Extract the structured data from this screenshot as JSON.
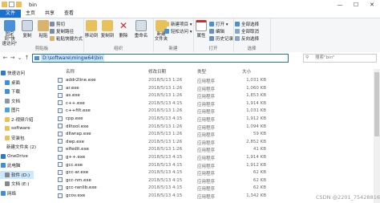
{
  "window": {
    "title": "bin",
    "minimize": "—",
    "maximize": "☐",
    "close": "✕"
  },
  "tabs": [
    "文件",
    "主页",
    "共享",
    "查看"
  ],
  "ribbon": {
    "clipboard": {
      "label": "剪贴板",
      "pin": "固定到\"快\n速访问\"",
      "copy": "复制",
      "paste": "粘贴",
      "cut": "剪切",
      "copy_path": "复制路径",
      "paste_shortcut": "粘贴快捷方式"
    },
    "organize": {
      "label": "组织",
      "move_to": "移动到",
      "copy_to": "复制到",
      "delete": "删除",
      "rename": "重命名"
    },
    "new": {
      "label": "新建",
      "new_folder": "新建\n文件夹",
      "new_item": "新建项目 ▾",
      "easy_access": "轻松访问 ▾"
    },
    "open": {
      "label": "打开",
      "properties": "属性",
      "open": "打开 ▾",
      "edit": "编辑",
      "history": "历史记录"
    },
    "select": {
      "label": "选择",
      "select_all": "全部选择",
      "select_none": "全部取消",
      "invert": "反向选择"
    }
  },
  "navbar": {
    "back": "←",
    "forward": "→",
    "recent": "⌄",
    "up": "↑",
    "path": "D:\\software\\mingw64\\bin",
    "search_placeholder": "搜索\"bin\"",
    "search_icon": "⚲"
  },
  "nav_pane": [
    {
      "label": "快速访问",
      "icon": "star-icon",
      "color": "#2b78d4"
    },
    {
      "label": "桌面",
      "icon": "desktop-icon",
      "color": "#3a8fdf"
    },
    {
      "label": "下载",
      "icon": "download-icon",
      "color": "#3a8fdf"
    },
    {
      "label": "文档",
      "icon": "document-icon",
      "color": "#8a97a6"
    },
    {
      "label": "图片",
      "icon": "picture-icon",
      "color": "#4aa3df"
    },
    {
      "label": "2-视频介绍",
      "icon": "folder-icon",
      "color": "#e8c15a"
    },
    {
      "label": "software",
      "icon": "folder-icon",
      "color": "#e8c15a"
    },
    {
      "label": "安装包",
      "icon": "folder-icon",
      "color": "#e8c15a"
    },
    {
      "label": "新建文件夹 (2)",
      "icon": "folder-icon",
      "color": "#e8c15a"
    },
    {
      "label": "OneDrive",
      "icon": "cloud-icon",
      "color": "#2b78d4"
    },
    {
      "label": "此电脑",
      "icon": "computer-icon",
      "color": "#3a8fdf"
    },
    {
      "label": "软件 (D:)",
      "icon": "drive-icon",
      "color": "#888"
    },
    {
      "label": "文档 (E:)",
      "icon": "drive-icon",
      "color": "#888"
    },
    {
      "label": "网络",
      "icon": "network-icon",
      "color": "#3a8fdf"
    }
  ],
  "columns": {
    "name": "名称",
    "date": "修改日期",
    "type": "类型",
    "size": "大小"
  },
  "files": [
    {
      "name": "addr2line.exe",
      "date": "2018/5/13 1:26",
      "type": "应用程序",
      "size": "1,031 KB"
    },
    {
      "name": "ar.exe",
      "date": "2018/5/13 1:26",
      "type": "应用程序",
      "size": "1,060 KB"
    },
    {
      "name": "as.exe",
      "date": "2018/5/13 1:26",
      "type": "应用程序",
      "size": "1,853 KB"
    },
    {
      "name": "c++.exe",
      "date": "2018/5/13 4:15",
      "type": "应用程序",
      "size": "1,914 KB"
    },
    {
      "name": "c++filt.exe",
      "date": "2018/5/13 1:26",
      "type": "应用程序",
      "size": "1,031 KB"
    },
    {
      "name": "cpp.exe",
      "date": "2018/5/13 4:15",
      "type": "应用程序",
      "size": "1,912 KB"
    },
    {
      "name": "dlltool.exe",
      "date": "2018/5/13 1:26",
      "type": "应用程序",
      "size": "1,094 KB"
    },
    {
      "name": "dllwrap.exe",
      "date": "2018/5/13 1:26",
      "type": "应用程序",
      "size": "59 KB"
    },
    {
      "name": "dwp.exe",
      "date": "2018/5/13 1:26",
      "type": "应用程序",
      "size": "2,852 KB"
    },
    {
      "name": "elfedit.exe",
      "date": "2018/5/13 1:26",
      "type": "应用程序",
      "size": "41 KB"
    },
    {
      "name": "g++.exe",
      "date": "2018/5/13 4:15",
      "type": "应用程序",
      "size": "1,914 KB"
    },
    {
      "name": "gcc.exe",
      "date": "2018/5/13 4:15",
      "type": "应用程序",
      "size": "1,912 KB"
    },
    {
      "name": "gcc-ar.exe",
      "date": "2018/5/13 4:15",
      "type": "应用程序",
      "size": "62 KB"
    },
    {
      "name": "gcc-nm.exe",
      "date": "2018/5/13 4:15",
      "type": "应用程序",
      "size": "62 KB"
    },
    {
      "name": "gcc-ranlib.exe",
      "date": "2018/5/13 4:15",
      "type": "应用程序",
      "size": "62 KB"
    },
    {
      "name": "gcov.exe",
      "date": "2018/5/13 4:15",
      "type": "应用程序",
      "size": "1,342 KB"
    }
  ],
  "watermark": "CSDN @2201_75428816"
}
